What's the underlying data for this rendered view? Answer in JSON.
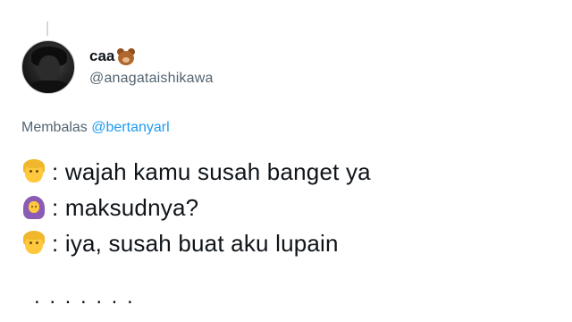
{
  "user": {
    "display_name": "caa",
    "handle": "@anagataishikawa",
    "name_emoji": "bear-face-icon"
  },
  "reply": {
    "prefix": "Membalas",
    "mention": "@bertanyarl"
  },
  "lines": [
    {
      "speaker_icon": "man-emoji-icon",
      "text": ": wajah kamu susah banget ya"
    },
    {
      "speaker_icon": "woman-with-headscarf-emoji-icon",
      "text": ": maksudnya?"
    },
    {
      "speaker_icon": "man-emoji-icon",
      "text": ": iya, susah buat aku lupain"
    }
  ],
  "trailing": ". . . . . . ."
}
